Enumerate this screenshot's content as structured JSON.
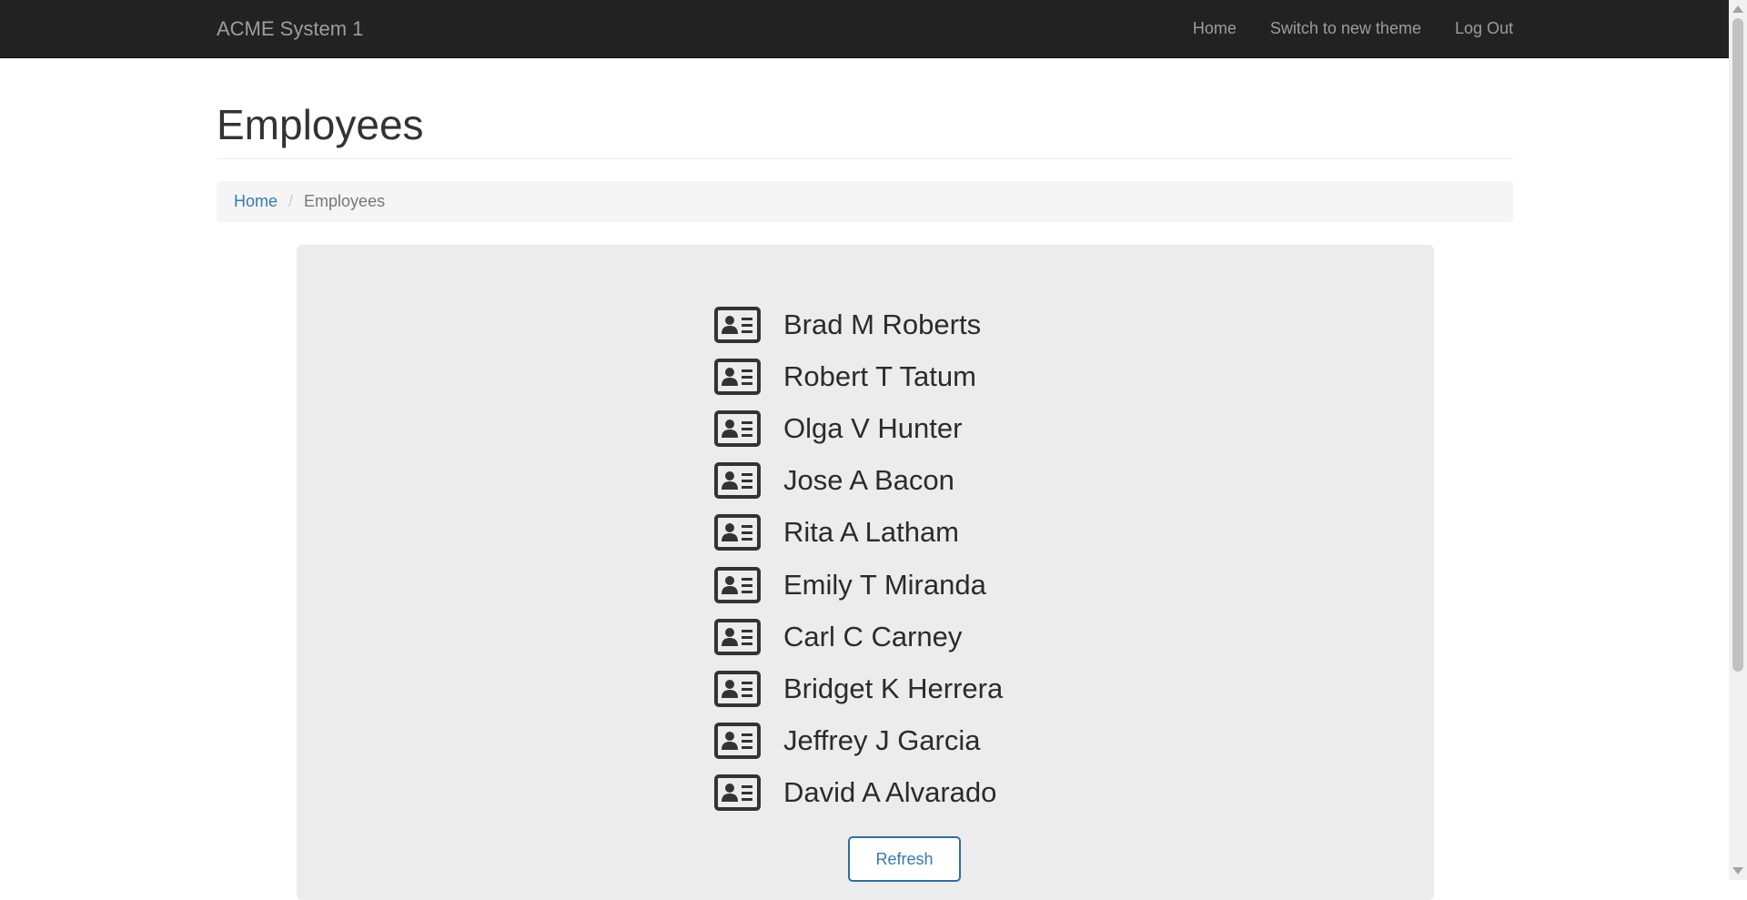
{
  "navbar": {
    "brand": "ACME System 1",
    "links": [
      {
        "label": "Home"
      },
      {
        "label": "Switch to new theme"
      },
      {
        "label": "Log Out"
      }
    ]
  },
  "page": {
    "title": "Employees"
  },
  "breadcrumb": {
    "home": "Home",
    "separator": "/",
    "current": "Employees"
  },
  "employees": {
    "icon": "id-card-icon",
    "items": [
      {
        "name": "Brad M Roberts"
      },
      {
        "name": "Robert T Tatum"
      },
      {
        "name": "Olga V Hunter"
      },
      {
        "name": "Jose A Bacon"
      },
      {
        "name": "Rita A Latham"
      },
      {
        "name": "Emily T Miranda"
      },
      {
        "name": "Carl C Carney"
      },
      {
        "name": "Bridget K Herrera"
      },
      {
        "name": "Jeffrey J Garcia"
      },
      {
        "name": "David A Alvarado"
      }
    ],
    "refresh_label": "Refresh"
  },
  "colors": {
    "navbar_bg": "#222222",
    "link": "#337ab7",
    "panel_bg": "#ececec",
    "icon": "#333333"
  }
}
